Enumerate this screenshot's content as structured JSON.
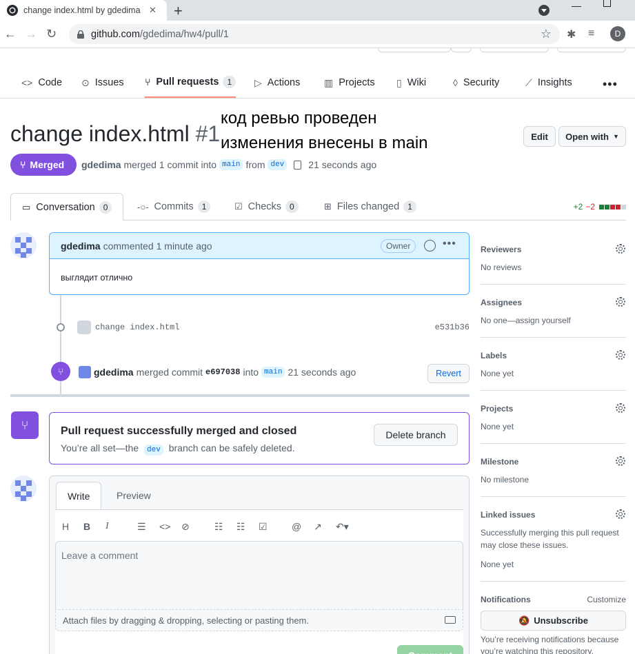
{
  "browser": {
    "tab_title": "change index.html by gdedima · ",
    "url_host": "github.com",
    "url_path": "/gdedima/hw4/pull/1",
    "profile_initial": "D"
  },
  "repo": {
    "name_partial": "gdedima / hw4"
  },
  "nav": {
    "code": "Code",
    "issues": "Issues",
    "pull_requests": "Pull requests",
    "pull_requests_count": "1",
    "actions": "Actions",
    "projects": "Projects",
    "wiki": "Wiki",
    "security": "Security",
    "insights": "Insights"
  },
  "pr": {
    "title": "change index.html",
    "number": "#1",
    "edit_label": "Edit",
    "open_with_label": "Open with",
    "status": "Merged",
    "author": "gdedima",
    "merged_text": "merged 1 commit into",
    "base_branch": "main",
    "from_text": "from",
    "head_branch": "dev",
    "time": "21 seconds ago"
  },
  "overlay": {
    "line1": "код ревью проведен",
    "line2": "изменения внесены в main"
  },
  "tabs": {
    "conversation": "Conversation",
    "conversation_count": "0",
    "commits": "Commits",
    "commits_count": "1",
    "checks": "Checks",
    "checks_count": "0",
    "files_changed": "Files changed",
    "files_changed_count": "1",
    "additions": "+2",
    "deletions": "−2"
  },
  "comment": {
    "author": "gdedima",
    "action": "commented 1 minute ago",
    "badge": "Owner",
    "body": "выглядит отлично"
  },
  "commit": {
    "message": "change index.html",
    "sha": "e531b36"
  },
  "merge_event": {
    "author": "gdedima",
    "text1": "merged commit",
    "sha": "e697038",
    "text2": "into",
    "branch": "main",
    "time": "21 seconds ago",
    "revert_label": "Revert"
  },
  "merged_box": {
    "heading": "Pull request successfully merged and closed",
    "text_before": "You’re all set—the",
    "branch": "dev",
    "text_after": "branch can be safely deleted.",
    "delete_label": "Delete branch"
  },
  "editor": {
    "write_tab": "Write",
    "preview_tab": "Preview",
    "placeholder": "Leave a comment",
    "attach_text": "Attach files by dragging & dropping, selecting or pasting them.",
    "submit_label": "Comment"
  },
  "sidebar": {
    "reviewers_title": "Reviewers",
    "reviewers_value": "No reviews",
    "assignees_title": "Assignees",
    "assignees_value": "No one—assign yourself",
    "labels_title": "Labels",
    "labels_value": "None yet",
    "projects_title": "Projects",
    "projects_value": "None yet",
    "milestone_title": "Milestone",
    "milestone_value": "No milestone",
    "linked_title": "Linked issues",
    "linked_desc1": "Successfully merging this pull request",
    "linked_desc2": "may close these issues.",
    "linked_value": "None yet",
    "notifications_title": "Notifications",
    "customize": "Customize",
    "unsubscribe": "Unsubscribe",
    "notif_desc1": "You’re receiving notifications because",
    "notif_desc2": "you’re watching this repository."
  },
  "colors": {
    "merged_purple": "#8250df",
    "link_blue": "#0969da",
    "add_green": "#1a7f37",
    "del_red": "#cf222e"
  }
}
